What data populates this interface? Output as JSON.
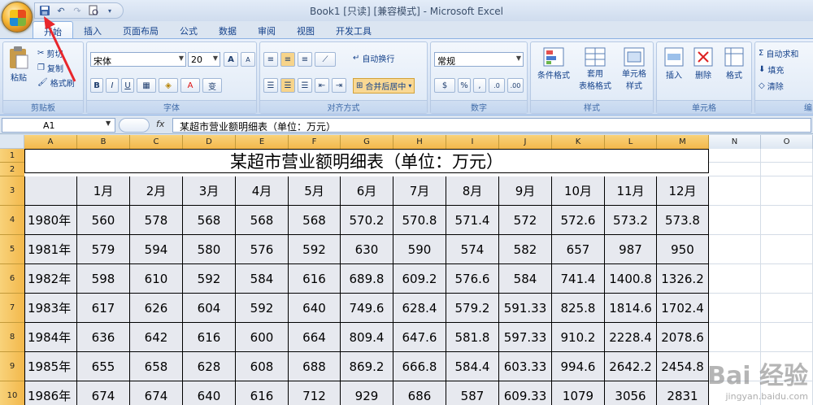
{
  "window": {
    "title": "Book1  [只读]  [兼容模式] - Microsoft Excel"
  },
  "qat": {
    "save": "save-icon",
    "undo": "undo-icon",
    "redo": "redo-icon",
    "print": "print-preview-icon"
  },
  "tabs": [
    "开始",
    "插入",
    "页面布局",
    "公式",
    "数据",
    "审阅",
    "视图",
    "开发工具"
  ],
  "clipboard": {
    "paste": "粘贴",
    "cut": "剪切",
    "copy": "复制",
    "format_painter": "格式刷",
    "label": "剪贴板"
  },
  "font": {
    "name": "宋体",
    "size": "20",
    "label": "字体",
    "bold": "B",
    "italic": "I",
    "underline": "U",
    "grow": "A",
    "shrink": "A",
    "phonetic": "变"
  },
  "alignment": {
    "wrap": "自动换行",
    "merge": "合并后居中",
    "label": "对齐方式"
  },
  "number": {
    "format": "常规",
    "percent": "%",
    "comma": ",",
    "label": "数字"
  },
  "styles": {
    "conditional": "条件格式",
    "table_line1": "套用",
    "table_line2": "表格格式",
    "cell_line1": "单元格",
    "cell_line2": "样式",
    "label": "样式"
  },
  "cells": {
    "insert": "插入",
    "delete": "删除",
    "format": "格式",
    "label": "单元格"
  },
  "editing": {
    "autosum": "自动求和",
    "fill": "填充",
    "clear": "清除",
    "label": "编"
  },
  "formula_bar": {
    "name_box": "A1",
    "fx": "fx",
    "formula": "某超市营业额明细表（单位：万元）"
  },
  "columns": [
    "A",
    "B",
    "C",
    "D",
    "E",
    "F",
    "G",
    "H",
    "I",
    "J",
    "K",
    "L",
    "M",
    "N",
    "O"
  ],
  "rows": [
    "1",
    "2",
    "3",
    "4",
    "5",
    "6",
    "7",
    "8",
    "9",
    "10"
  ],
  "sheet": {
    "title": "某超市营业额明细表（单位：万元）",
    "months": [
      "1月",
      "2月",
      "3月",
      "4月",
      "5月",
      "6月",
      "7月",
      "8月",
      "9月",
      "10月",
      "11月",
      "12月"
    ],
    "data": [
      {
        "year": "1980年",
        "values": [
          "560",
          "578",
          "568",
          "568",
          "568",
          "570.2",
          "570.8",
          "571.4",
          "572",
          "572.6",
          "573.2",
          "573.8"
        ]
      },
      {
        "year": "1981年",
        "values": [
          "579",
          "594",
          "580",
          "576",
          "592",
          "630",
          "590",
          "574",
          "582",
          "657",
          "987",
          "950"
        ]
      },
      {
        "year": "1982年",
        "values": [
          "598",
          "610",
          "592",
          "584",
          "616",
          "689.8",
          "609.2",
          "576.6",
          "584",
          "741.4",
          "1400.8",
          "1326.2"
        ]
      },
      {
        "year": "1983年",
        "values": [
          "617",
          "626",
          "604",
          "592",
          "640",
          "749.6",
          "628.4",
          "579.2",
          "591.33",
          "825.8",
          "1814.6",
          "1702.4"
        ]
      },
      {
        "year": "1984年",
        "values": [
          "636",
          "642",
          "616",
          "600",
          "664",
          "809.4",
          "647.6",
          "581.8",
          "597.33",
          "910.2",
          "2228.4",
          "2078.6"
        ]
      },
      {
        "year": "1985年",
        "values": [
          "655",
          "658",
          "628",
          "608",
          "688",
          "869.2",
          "666.8",
          "584.4",
          "603.33",
          "994.6",
          "2642.2",
          "2454.8"
        ]
      },
      {
        "year": "1986年",
        "values": [
          "674",
          "674",
          "640",
          "616",
          "712",
          "929",
          "686",
          "587",
          "609.33",
          "1079",
          "3056",
          "2831"
        ]
      }
    ]
  },
  "watermark": {
    "main": "Bai 经验",
    "sub": "jingyan.baidu.com"
  }
}
